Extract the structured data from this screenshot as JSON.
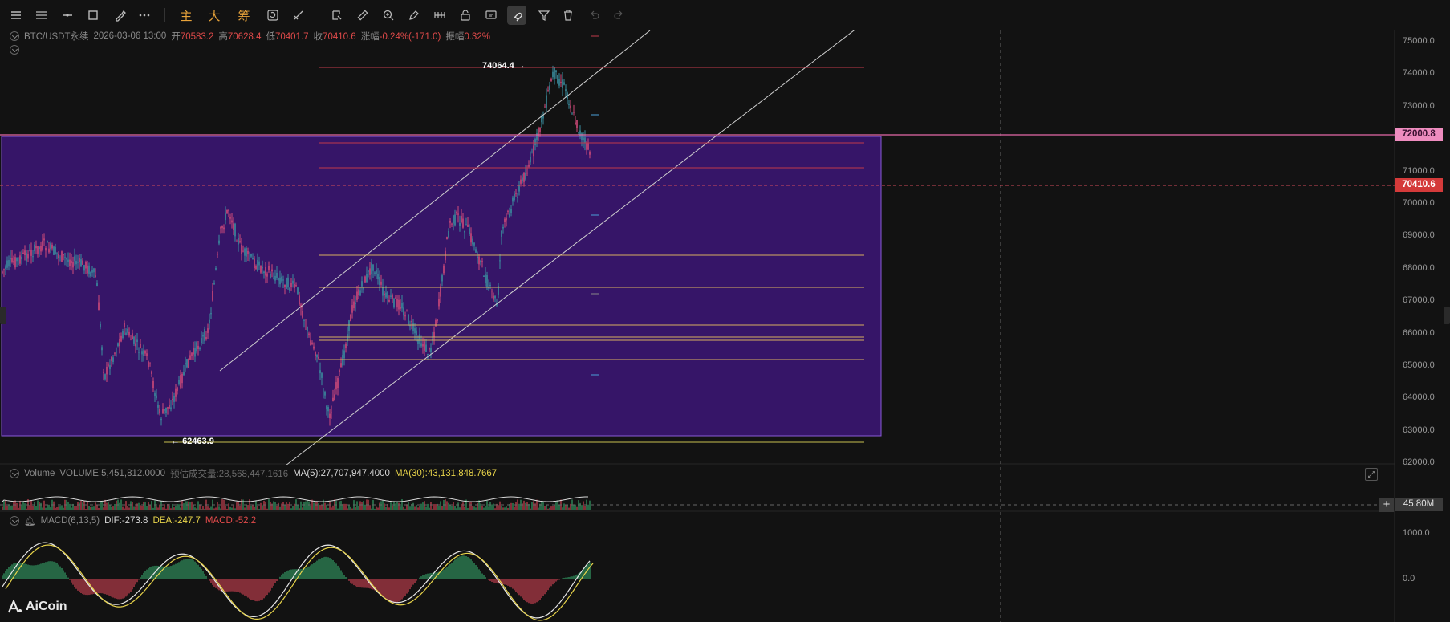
{
  "toolbar": {
    "items": [
      "menu-icon",
      "list-icon",
      "horizontal-line-icon",
      "rectangle-icon",
      "brush-icon",
      "more-icon"
    ],
    "labels": {
      "main": "主",
      "big": "大",
      "chips": "筹"
    },
    "tools": [
      "refresh-icon",
      "ruler-pen-icon",
      "annotate-icon",
      "ruler-icon",
      "zoom-icon",
      "pencil-icon",
      "pattern-icon",
      "lock-icon",
      "screenshot-icon",
      "magnet-icon",
      "filter-icon",
      "trash-icon",
      "undo-icon",
      "redo-icon"
    ]
  },
  "ohlc": {
    "symbol": "BTC/USDT永续",
    "datetime": "2026-03-06 13:00",
    "open_label": "开",
    "open": "70583.2",
    "high_label": "高",
    "high": "70628.4",
    "low_label": "低",
    "low": "70401.7",
    "close_label": "收",
    "close": "70410.6",
    "change_label": "涨幅",
    "change": "-0.24%(-171.0)",
    "amplitude_label": "振幅",
    "amplitude": "0.32%"
  },
  "price_axis": {
    "ticks": [
      "75000.0",
      "74000.0",
      "73000.0",
      "72000.0",
      "71000.0",
      "70000.0",
      "69000.0",
      "68000.0",
      "67000.0",
      "66000.0",
      "65000.0",
      "64000.0",
      "63000.0",
      "62000.0"
    ],
    "tag_level": "72000.8",
    "tag_last": "70410.6"
  },
  "annotations": {
    "high": "74064.4",
    "high_arrow": "→",
    "low": "62463.9",
    "low_arrow": "←"
  },
  "volume": {
    "title": "Volume",
    "vol_label": "VOLUME:5,451,812.0000",
    "est_label": "预估成交量:28,568,447.1616",
    "ma5": "MA(5):27,707,947.4000",
    "ma30": "MA(30):43,131,848.7667",
    "tag": "45.80M"
  },
  "macd": {
    "title": "MACD(6,13,5)",
    "dif": "DIF:-273.8",
    "dea": "DEA:-247.7",
    "macd": "MACD:-52.2",
    "ticks": [
      "1000.0",
      "0.0"
    ]
  },
  "brand": {
    "name": "AiCoin"
  },
  "colors": {
    "up": "#3aa776",
    "down": "#d04a5a",
    "box": "#3a1670",
    "box_border": "#8a5ad8",
    "level_pink": "#e66aa8",
    "accent": "#e8a33a"
  }
}
